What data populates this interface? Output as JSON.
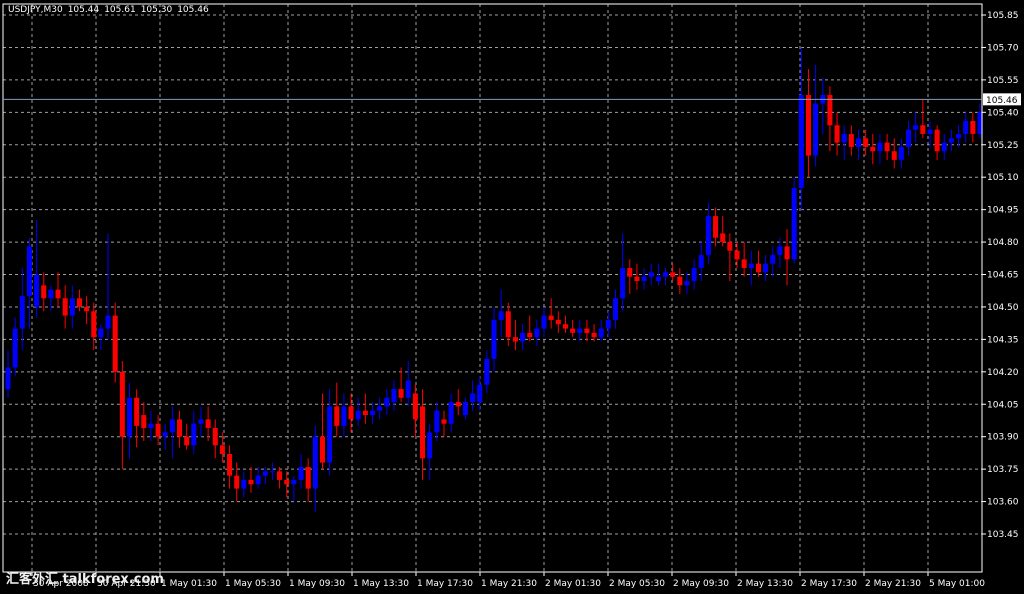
{
  "header": {
    "symbol": "USDJPY,M30",
    "open": "105.44",
    "high": "105.61",
    "low": "105.30",
    "close": "105.46"
  },
  "watermark": "汇客外汇 talkforex.com",
  "colors": {
    "background": "#000000",
    "grid": "#a0a0a0",
    "axis": "#ffffff",
    "bull": "#0000ff",
    "bear": "#ff0000",
    "price_line": "#7f9fbf"
  },
  "chart_data": {
    "type": "candlestick",
    "ylim": [
      105.4,
      105.85
    ],
    "yticks": [
      103.45,
      103.6,
      103.75,
      103.9,
      104.05,
      104.2,
      104.35,
      104.5,
      104.65,
      104.8,
      104.95,
      105.1,
      105.25,
      105.4,
      105.55,
      105.7,
      105.85
    ],
    "current_price": 105.46,
    "current_price_label": "105.46",
    "xticks": [
      "30 Apr 2008",
      "30 Apr 21:30",
      "1 May 01:30",
      "1 May 05:30",
      "1 May 09:30",
      "1 May 13:30",
      "1 May 17:30",
      "1 May 21:30",
      "2 May 01:30",
      "2 May 05:30",
      "2 May 09:30",
      "2 May 13:30",
      "2 May 17:30",
      "2 May 21:30",
      "5 May 01:00"
    ],
    "candles": [
      {
        "o": 104.12,
        "h": 104.3,
        "l": 104.08,
        "c": 104.22
      },
      {
        "o": 104.22,
        "h": 104.45,
        "l": 104.18,
        "c": 104.4
      },
      {
        "o": 104.4,
        "h": 104.68,
        "l": 104.3,
        "c": 104.55
      },
      {
        "o": 104.55,
        "h": 104.82,
        "l": 104.4,
        "c": 104.78
      },
      {
        "o": 104.5,
        "h": 104.9,
        "l": 104.45,
        "c": 104.65
      },
      {
        "o": 104.6,
        "h": 104.66,
        "l": 104.48,
        "c": 104.54
      },
      {
        "o": 104.54,
        "h": 104.6,
        "l": 104.48,
        "c": 104.58
      },
      {
        "o": 104.58,
        "h": 104.66,
        "l": 104.5,
        "c": 104.54
      },
      {
        "o": 104.54,
        "h": 104.6,
        "l": 104.4,
        "c": 104.46
      },
      {
        "o": 104.46,
        "h": 104.6,
        "l": 104.4,
        "c": 104.54
      },
      {
        "o": 104.54,
        "h": 104.58,
        "l": 104.48,
        "c": 104.5
      },
      {
        "o": 104.5,
        "h": 104.55,
        "l": 104.42,
        "c": 104.48
      },
      {
        "o": 104.48,
        "h": 104.52,
        "l": 104.3,
        "c": 104.36
      },
      {
        "o": 104.36,
        "h": 104.42,
        "l": 104.3,
        "c": 104.4
      },
      {
        "o": 104.4,
        "h": 104.84,
        "l": 104.35,
        "c": 104.46
      },
      {
        "o": 104.46,
        "h": 104.52,
        "l": 104.15,
        "c": 104.2
      },
      {
        "o": 104.2,
        "h": 104.25,
        "l": 103.75,
        "c": 103.9
      },
      {
        "o": 103.9,
        "h": 104.15,
        "l": 103.8,
        "c": 104.08
      },
      {
        "o": 104.08,
        "h": 104.12,
        "l": 103.85,
        "c": 103.95
      },
      {
        "o": 104.0,
        "h": 104.06,
        "l": 103.88,
        "c": 103.94
      },
      {
        "o": 103.94,
        "h": 104.02,
        "l": 103.88,
        "c": 103.96
      },
      {
        "o": 103.96,
        "h": 104.0,
        "l": 103.86,
        "c": 103.9
      },
      {
        "o": 103.9,
        "h": 103.96,
        "l": 103.84,
        "c": 103.92
      },
      {
        "o": 103.92,
        "h": 104.04,
        "l": 103.8,
        "c": 103.98
      },
      {
        "o": 103.98,
        "h": 104.02,
        "l": 103.85,
        "c": 103.9
      },
      {
        "o": 103.9,
        "h": 103.96,
        "l": 103.84,
        "c": 103.86
      },
      {
        "o": 103.86,
        "h": 104.02,
        "l": 103.82,
        "c": 103.96
      },
      {
        "o": 103.96,
        "h": 104.04,
        "l": 103.9,
        "c": 103.98
      },
      {
        "o": 103.98,
        "h": 104.04,
        "l": 103.88,
        "c": 103.94
      },
      {
        "o": 103.94,
        "h": 103.98,
        "l": 103.8,
        "c": 103.86
      },
      {
        "o": 103.86,
        "h": 103.92,
        "l": 103.78,
        "c": 103.82
      },
      {
        "o": 103.82,
        "h": 103.86,
        "l": 103.66,
        "c": 103.72
      },
      {
        "o": 103.72,
        "h": 103.78,
        "l": 103.6,
        "c": 103.66
      },
      {
        "o": 103.66,
        "h": 103.74,
        "l": 103.62,
        "c": 103.7
      },
      {
        "o": 103.7,
        "h": 103.76,
        "l": 103.64,
        "c": 103.68
      },
      {
        "o": 103.68,
        "h": 103.76,
        "l": 103.66,
        "c": 103.72
      },
      {
        "o": 103.72,
        "h": 103.76,
        "l": 103.68,
        "c": 103.74
      },
      {
        "o": 103.74,
        "h": 103.78,
        "l": 103.7,
        "c": 103.74
      },
      {
        "o": 103.74,
        "h": 103.76,
        "l": 103.66,
        "c": 103.7
      },
      {
        "o": 103.7,
        "h": 103.74,
        "l": 103.62,
        "c": 103.68
      },
      {
        "o": 103.68,
        "h": 103.72,
        "l": 103.6,
        "c": 103.7
      },
      {
        "o": 103.7,
        "h": 103.82,
        "l": 103.66,
        "c": 103.76
      },
      {
        "o": 103.76,
        "h": 103.8,
        "l": 103.6,
        "c": 103.66
      },
      {
        "o": 103.66,
        "h": 103.95,
        "l": 103.55,
        "c": 103.9
      },
      {
        "o": 103.9,
        "h": 104.1,
        "l": 103.75,
        "c": 103.78
      },
      {
        "o": 103.78,
        "h": 104.12,
        "l": 103.72,
        "c": 104.04
      },
      {
        "o": 104.04,
        "h": 104.15,
        "l": 103.9,
        "c": 103.95
      },
      {
        "o": 103.95,
        "h": 104.1,
        "l": 103.9,
        "c": 104.04
      },
      {
        "o": 104.04,
        "h": 104.1,
        "l": 103.92,
        "c": 103.98
      },
      {
        "o": 103.98,
        "h": 104.08,
        "l": 103.95,
        "c": 104.02
      },
      {
        "o": 104.02,
        "h": 104.1,
        "l": 103.96,
        "c": 104.0
      },
      {
        "o": 104.0,
        "h": 104.06,
        "l": 103.96,
        "c": 104.02
      },
      {
        "o": 104.02,
        "h": 104.08,
        "l": 103.98,
        "c": 104.04
      },
      {
        "o": 104.04,
        "h": 104.12,
        "l": 104.0,
        "c": 104.08
      },
      {
        "o": 104.06,
        "h": 104.16,
        "l": 104.02,
        "c": 104.12
      },
      {
        "o": 104.12,
        "h": 104.22,
        "l": 104.06,
        "c": 104.08
      },
      {
        "o": 104.08,
        "h": 104.25,
        "l": 104.04,
        "c": 104.16
      },
      {
        "o": 104.1,
        "h": 104.14,
        "l": 103.9,
        "c": 103.98
      },
      {
        "o": 104.04,
        "h": 104.12,
        "l": 103.7,
        "c": 103.8
      },
      {
        "o": 103.8,
        "h": 103.96,
        "l": 103.7,
        "c": 103.92
      },
      {
        "o": 103.92,
        "h": 104.06,
        "l": 103.88,
        "c": 104.02
      },
      {
        "o": 103.98,
        "h": 104.02,
        "l": 103.9,
        "c": 103.96
      },
      {
        "o": 103.96,
        "h": 104.1,
        "l": 103.92,
        "c": 104.06
      },
      {
        "o": 104.06,
        "h": 104.12,
        "l": 104.0,
        "c": 104.04
      },
      {
        "o": 104.0,
        "h": 104.08,
        "l": 103.98,
        "c": 104.06
      },
      {
        "o": 104.06,
        "h": 104.16,
        "l": 104.02,
        "c": 104.1
      },
      {
        "o": 104.06,
        "h": 104.18,
        "l": 104.02,
        "c": 104.14
      },
      {
        "o": 104.14,
        "h": 104.3,
        "l": 104.1,
        "c": 104.26
      },
      {
        "o": 104.26,
        "h": 104.5,
        "l": 104.2,
        "c": 104.44
      },
      {
        "o": 104.44,
        "h": 104.58,
        "l": 104.36,
        "c": 104.48
      },
      {
        "o": 104.48,
        "h": 104.52,
        "l": 104.32,
        "c": 104.36
      },
      {
        "o": 104.36,
        "h": 104.44,
        "l": 104.3,
        "c": 104.34
      },
      {
        "o": 104.34,
        "h": 104.42,
        "l": 104.3,
        "c": 104.38
      },
      {
        "o": 104.38,
        "h": 104.46,
        "l": 104.34,
        "c": 104.36
      },
      {
        "o": 104.36,
        "h": 104.44,
        "l": 104.32,
        "c": 104.4
      },
      {
        "o": 104.4,
        "h": 104.5,
        "l": 104.36,
        "c": 104.46
      },
      {
        "o": 104.46,
        "h": 104.54,
        "l": 104.4,
        "c": 104.44
      },
      {
        "o": 104.44,
        "h": 104.48,
        "l": 104.38,
        "c": 104.42
      },
      {
        "o": 104.42,
        "h": 104.46,
        "l": 104.38,
        "c": 104.4
      },
      {
        "o": 104.4,
        "h": 104.44,
        "l": 104.36,
        "c": 104.38
      },
      {
        "o": 104.38,
        "h": 104.44,
        "l": 104.34,
        "c": 104.4
      },
      {
        "o": 104.4,
        "h": 104.44,
        "l": 104.34,
        "c": 104.38
      },
      {
        "o": 104.38,
        "h": 104.42,
        "l": 104.34,
        "c": 104.36
      },
      {
        "o": 104.36,
        "h": 104.44,
        "l": 104.34,
        "c": 104.4
      },
      {
        "o": 104.4,
        "h": 104.48,
        "l": 104.36,
        "c": 104.44
      },
      {
        "o": 104.44,
        "h": 104.58,
        "l": 104.4,
        "c": 104.54
      },
      {
        "o": 104.54,
        "h": 104.84,
        "l": 104.48,
        "c": 104.68
      },
      {
        "o": 104.68,
        "h": 104.72,
        "l": 104.56,
        "c": 104.64
      },
      {
        "o": 104.64,
        "h": 104.7,
        "l": 104.58,
        "c": 104.62
      },
      {
        "o": 104.62,
        "h": 104.68,
        "l": 104.58,
        "c": 104.64
      },
      {
        "o": 104.64,
        "h": 104.7,
        "l": 104.6,
        "c": 104.66
      },
      {
        "o": 104.62,
        "h": 104.7,
        "l": 104.6,
        "c": 104.64
      },
      {
        "o": 104.64,
        "h": 104.68,
        "l": 104.6,
        "c": 104.66
      },
      {
        "o": 104.66,
        "h": 104.7,
        "l": 104.62,
        "c": 104.64
      },
      {
        "o": 104.64,
        "h": 104.68,
        "l": 104.56,
        "c": 104.6
      },
      {
        "o": 104.6,
        "h": 104.66,
        "l": 104.56,
        "c": 104.62
      },
      {
        "o": 104.62,
        "h": 104.72,
        "l": 104.58,
        "c": 104.68
      },
      {
        "o": 104.68,
        "h": 104.8,
        "l": 104.62,
        "c": 104.74
      },
      {
        "o": 104.74,
        "h": 104.98,
        "l": 104.7,
        "c": 104.92
      },
      {
        "o": 104.92,
        "h": 104.96,
        "l": 104.78,
        "c": 104.82
      },
      {
        "o": 104.84,
        "h": 104.92,
        "l": 104.78,
        "c": 104.8
      },
      {
        "o": 104.8,
        "h": 104.84,
        "l": 104.62,
        "c": 104.76
      },
      {
        "o": 104.76,
        "h": 104.8,
        "l": 104.68,
        "c": 104.72
      },
      {
        "o": 104.72,
        "h": 104.8,
        "l": 104.64,
        "c": 104.68
      },
      {
        "o": 104.68,
        "h": 104.76,
        "l": 104.6,
        "c": 104.7
      },
      {
        "o": 104.7,
        "h": 104.76,
        "l": 104.64,
        "c": 104.66
      },
      {
        "o": 104.66,
        "h": 104.74,
        "l": 104.62,
        "c": 104.7
      },
      {
        "o": 104.7,
        "h": 104.78,
        "l": 104.64,
        "c": 104.74
      },
      {
        "o": 104.74,
        "h": 104.82,
        "l": 104.68,
        "c": 104.78
      },
      {
        "o": 104.78,
        "h": 104.86,
        "l": 104.6,
        "c": 104.72
      },
      {
        "o": 104.72,
        "h": 105.1,
        "l": 104.7,
        "c": 105.05
      },
      {
        "o": 105.05,
        "h": 105.7,
        "l": 104.95,
        "c": 105.48
      },
      {
        "o": 105.48,
        "h": 105.6,
        "l": 105.1,
        "c": 105.2
      },
      {
        "o": 105.2,
        "h": 105.62,
        "l": 105.15,
        "c": 105.44
      },
      {
        "o": 105.44,
        "h": 105.56,
        "l": 105.3,
        "c": 105.48
      },
      {
        "o": 105.48,
        "h": 105.52,
        "l": 105.22,
        "c": 105.34
      },
      {
        "o": 105.34,
        "h": 105.4,
        "l": 105.2,
        "c": 105.26
      },
      {
        "o": 105.26,
        "h": 105.34,
        "l": 105.18,
        "c": 105.3
      },
      {
        "o": 105.3,
        "h": 105.34,
        "l": 105.2,
        "c": 105.24
      },
      {
        "o": 105.24,
        "h": 105.32,
        "l": 105.18,
        "c": 105.28
      },
      {
        "o": 105.28,
        "h": 105.32,
        "l": 105.2,
        "c": 105.24
      },
      {
        "o": 105.24,
        "h": 105.3,
        "l": 105.16,
        "c": 105.22
      },
      {
        "o": 105.22,
        "h": 105.3,
        "l": 105.16,
        "c": 105.26
      },
      {
        "o": 105.26,
        "h": 105.3,
        "l": 105.18,
        "c": 105.22
      },
      {
        "o": 105.22,
        "h": 105.28,
        "l": 105.14,
        "c": 105.18
      },
      {
        "o": 105.18,
        "h": 105.28,
        "l": 105.14,
        "c": 105.24
      },
      {
        "o": 105.24,
        "h": 105.36,
        "l": 105.2,
        "c": 105.32
      },
      {
        "o": 105.32,
        "h": 105.4,
        "l": 105.26,
        "c": 105.34
      },
      {
        "o": 105.34,
        "h": 105.46,
        "l": 105.28,
        "c": 105.3
      },
      {
        "o": 105.3,
        "h": 105.36,
        "l": 105.24,
        "c": 105.32
      },
      {
        "o": 105.32,
        "h": 105.34,
        "l": 105.18,
        "c": 105.22
      },
      {
        "o": 105.22,
        "h": 105.3,
        "l": 105.18,
        "c": 105.26
      },
      {
        "o": 105.26,
        "h": 105.32,
        "l": 105.22,
        "c": 105.28
      },
      {
        "o": 105.28,
        "h": 105.34,
        "l": 105.24,
        "c": 105.3
      },
      {
        "o": 105.3,
        "h": 105.4,
        "l": 105.26,
        "c": 105.36
      },
      {
        "o": 105.36,
        "h": 105.4,
        "l": 105.26,
        "c": 105.3
      },
      {
        "o": 105.3,
        "h": 105.44,
        "l": 105.28,
        "c": 105.4
      }
    ]
  }
}
